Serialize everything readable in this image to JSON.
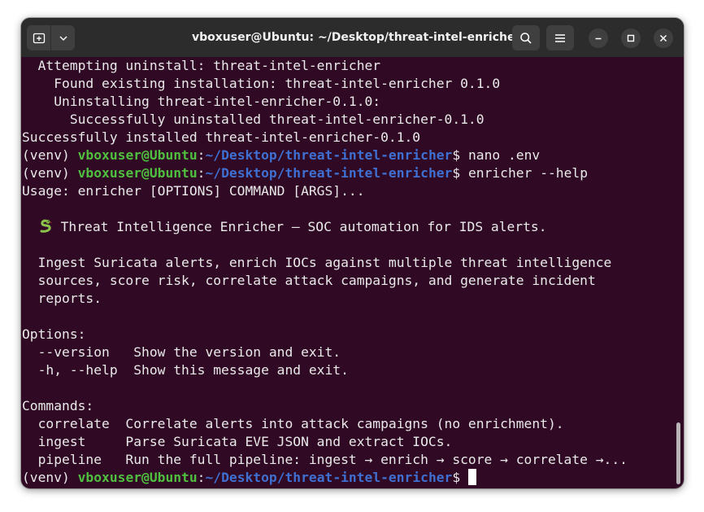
{
  "window": {
    "title": "vboxuser@Ubuntu: ~/Desktop/threat-intel-enricher"
  },
  "prompt": {
    "venv": "(venv) ",
    "user_host": "vboxuser@Ubuntu",
    "colon": ":",
    "path": "~/Desktop/threat-intel-enricher",
    "dollar": "$ "
  },
  "terminal": {
    "l1": "  Attempting uninstall: threat-intel-enricher",
    "l2": "    Found existing installation: threat-intel-enricher 0.1.0",
    "l3": "    Uninstalling threat-intel-enricher-0.1.0:",
    "l4": "      Successfully uninstalled threat-intel-enricher-0.1.0",
    "l5": "Successfully installed threat-intel-enricher-0.1.0",
    "cmd1": "nano .env",
    "cmd2": "enricher --help",
    "usage": "Usage: enricher [OPTIONS] COMMAND [ARGS]...",
    "desc_title": "Threat Intelligence Enricher — SOC automation for IDS alerts.",
    "desc1": "  Ingest Suricata alerts, enrich IOCs against multiple threat intelligence",
    "desc2": "  sources, score risk, correlate attack campaigns, and generate incident",
    "desc3": "  reports.",
    "options_header": "Options:",
    "opt1": "  --version   Show the version and exit.",
    "opt2": "  -h, --help  Show this message and exit.",
    "commands_header": "Commands:",
    "cmd_correlate": "  correlate  Correlate alerts into attack campaigns (no enrichment).",
    "cmd_ingest": "  ingest     Parse Suricata EVE JSON and extract IOCs.",
    "cmd_pipeline": "  pipeline   Run the full pipeline: ingest → enrich → score → correlate →..."
  },
  "icons": {
    "new_tab": "new-tab-icon",
    "menu_dropdown": "chevron-down-icon",
    "search": "search-icon",
    "hamburger": "hamburger-menu-icon",
    "minimize": "minimize-icon",
    "maximize": "maximize-icon",
    "close": "close-icon",
    "snake": "snake-emoji-icon"
  },
  "colors": {
    "terminal_bg": "#300a24",
    "titlebar_bg": "#2c2c2c",
    "prompt_user": "#4fbf3f",
    "prompt_path": "#3e6fd1",
    "text": "#e9e9e9"
  }
}
